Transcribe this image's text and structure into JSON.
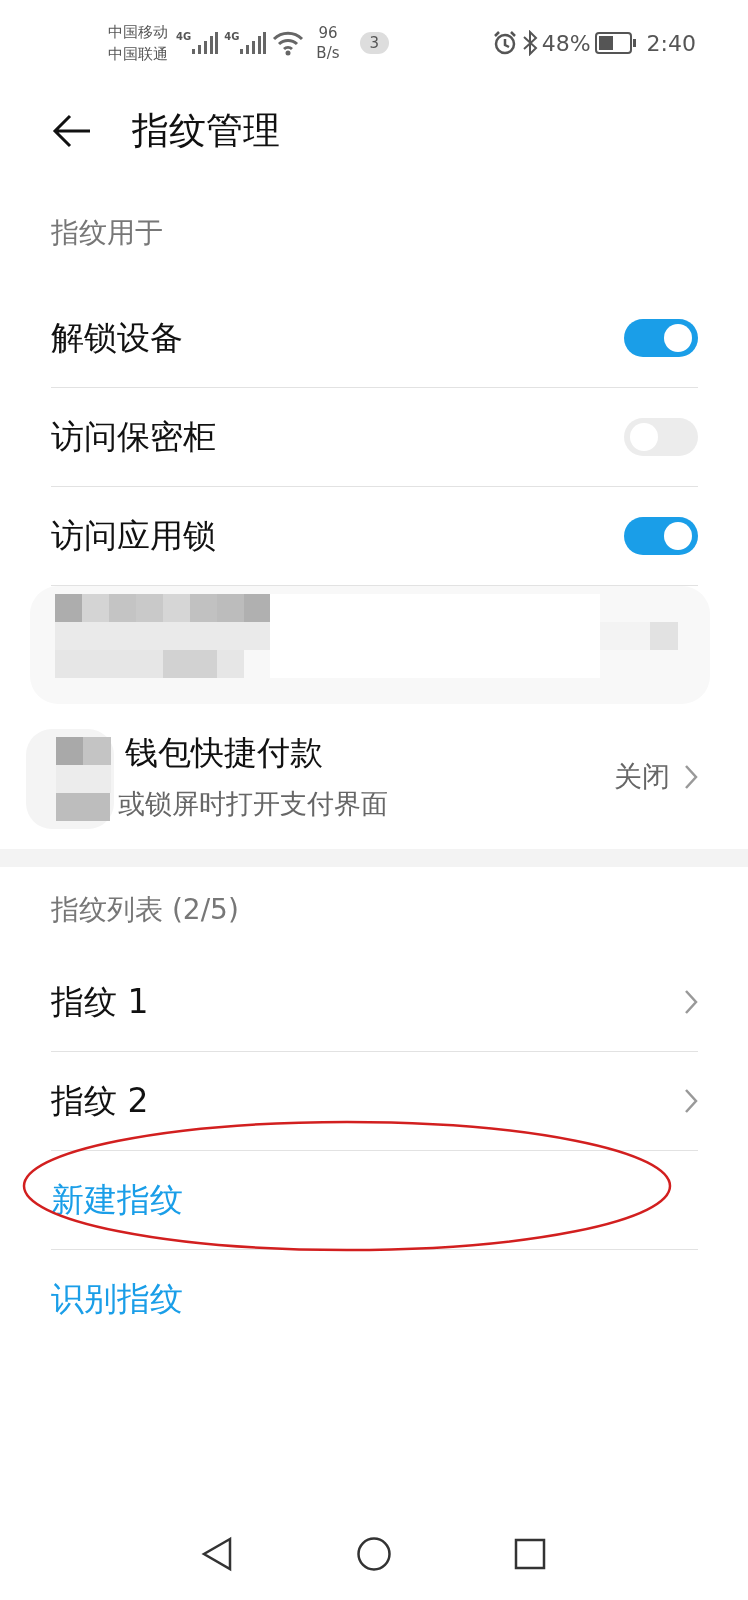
{
  "status_bar": {
    "carriers": [
      "中国移动",
      "中国联通"
    ],
    "network_badges": [
      "4G",
      "4G"
    ],
    "speed_value": "96",
    "speed_unit": "B/s",
    "notification_count": "3",
    "battery_percent": "48%",
    "time": "2:40"
  },
  "header": {
    "title": "指纹管理"
  },
  "sections": [
    {
      "label": "指纹用于",
      "items": [
        {
          "kind": "toggle",
          "title": "解锁设备",
          "on": true
        },
        {
          "kind": "toggle",
          "title": "访问保密柜",
          "on": false
        },
        {
          "kind": "toggle",
          "title": "访问应用锁",
          "on": true
        },
        {
          "kind": "redacted"
        },
        {
          "kind": "value",
          "title": "钱包快捷付款",
          "subtitle": "或锁屏时打开支付界面",
          "value": "关闭"
        }
      ]
    },
    {
      "label": "指纹列表 (2/5)",
      "items": [
        {
          "kind": "nav",
          "title": "指纹 1",
          "highlighted": false
        },
        {
          "kind": "nav",
          "title": "指纹 2",
          "highlighted": false
        },
        {
          "kind": "action",
          "title": "新建指纹",
          "highlighted": true
        },
        {
          "kind": "action",
          "title": "识别指纹",
          "highlighted": false
        }
      ]
    }
  ]
}
